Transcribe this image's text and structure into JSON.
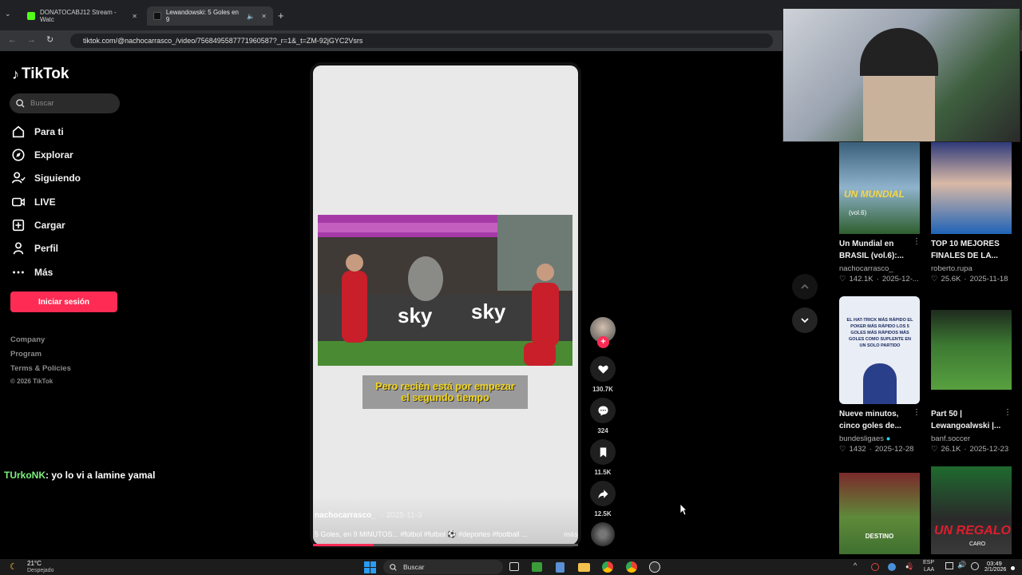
{
  "browser": {
    "tabs": [
      {
        "label": "DONATOCABJ12 Stream - Watc"
      },
      {
        "label": "Lewandowski: 5 Goles en 9"
      }
    ],
    "url": "tiktok.com/@nachocarrasco_/video/7568495587771960587?_r=1&_t=ZM-92jGYC2Vsrs"
  },
  "sidebar": {
    "logo": "TikTok",
    "search_placeholder": "Buscar",
    "items": [
      {
        "label": "Para ti",
        "icon": "home-icon"
      },
      {
        "label": "Explorar",
        "icon": "compass-icon"
      },
      {
        "label": "Siguiendo",
        "icon": "following-icon"
      },
      {
        "label": "LIVE",
        "icon": "live-icon"
      },
      {
        "label": "Cargar",
        "icon": "upload-icon"
      },
      {
        "label": "Perfil",
        "icon": "profile-icon"
      },
      {
        "label": "Más",
        "icon": "more-icon"
      }
    ],
    "login_label": "Iniciar sesión",
    "footer": [
      "Company",
      "Program",
      "Terms & Policies",
      "© 2026 TikTok"
    ]
  },
  "chat": {
    "user": "TUrkoNK",
    "message": ": yo lo vi a lamine yamal"
  },
  "video": {
    "caption_line1": "Pero recién está por empezar",
    "caption_line2": "el segundo tiempo",
    "author": "nachocarrasco_",
    "date": "· 2025-11-3",
    "description": "5 Goles, en 9 MINUTOS... #fútbol #futbol ⚽ #deportes #football ...",
    "more": "más",
    "progress": 0.23
  },
  "actions": {
    "likes": "130.7K",
    "comments": "324",
    "saves": "11.5K",
    "shares": "12.5K"
  },
  "related": [
    {
      "title": "Un Mundial en BRASIL (vol.6):...",
      "author": "nachocarrasco_",
      "likes": "142.1K",
      "date": "2025-12-...",
      "thumb_text": "UN MUNDIAL",
      "thumb_sub": "(vol.6)"
    },
    {
      "title": "TOP 10 MEJORES FINALES DE LA...",
      "author": "roberto.rupa",
      "likes": "25.6K",
      "date": "2025-11-18"
    },
    {
      "title": "Nueve minutos, cinco goles de...",
      "author": "bundesligaes",
      "likes": "1432",
      "date": "2025-12-28",
      "thumb_text": "EL HAT-TRICK MÁS RÁPIDO EL POKER MÁS RÁPIDO LOS 5 GOLES MÁS RÁPIDOS MÁS GOLES COMO SUPLENTE EN UN SOLO PARTIDO"
    },
    {
      "title": "Part 50 | Lewangoalwski |...",
      "author": "banf.soccer",
      "likes": "26.1K",
      "date": "2025-12-23"
    },
    {
      "thumb_text": "DESTINO"
    },
    {
      "thumb_text": "UN REGALO",
      "thumb_sub": "CARO"
    }
  ],
  "taskbar": {
    "temp": "21°C",
    "weather": "Despejado",
    "search": "Buscar",
    "lang1": "ESP",
    "lang2": "LAA",
    "time": "03:49",
    "date": "2/1/2026"
  },
  "colors": {
    "accent": "#fe2c55",
    "chat_user": "#7cf27c",
    "taskbar": "#1c1c1c"
  }
}
